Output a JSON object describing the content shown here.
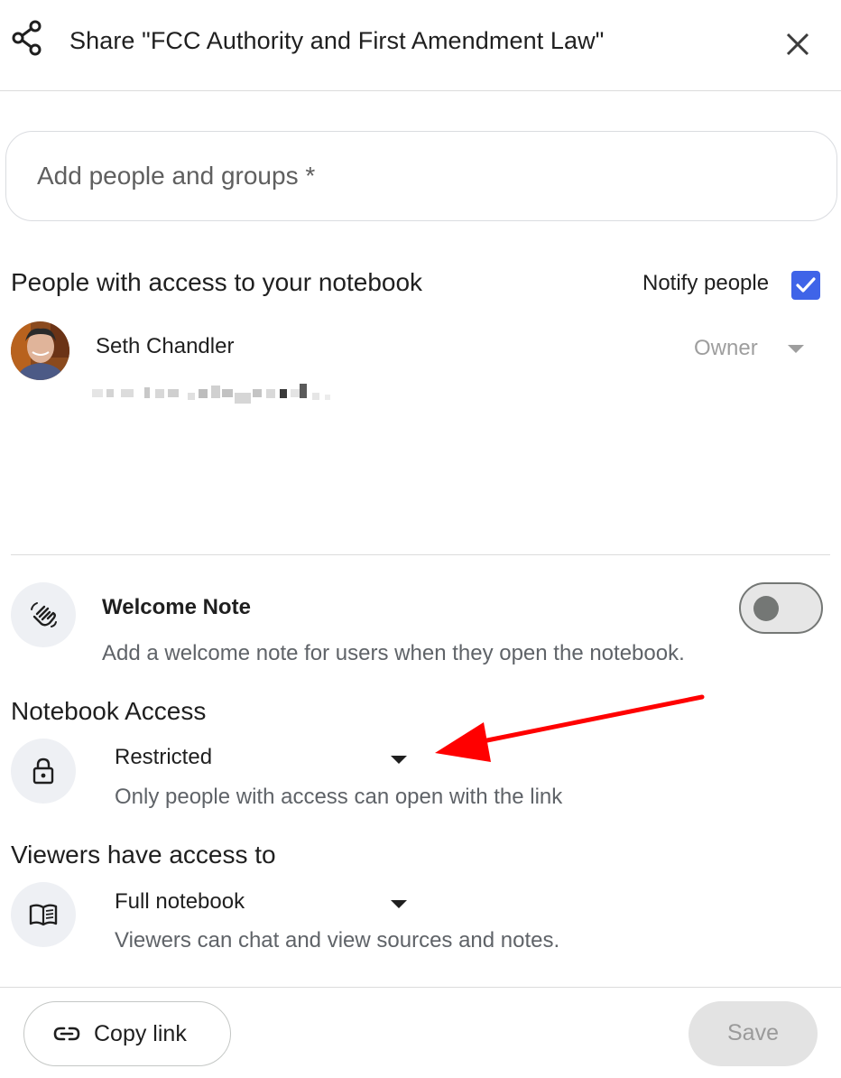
{
  "header": {
    "title": "Share \"FCC Authority and First Amendment Law\""
  },
  "add_people": {
    "placeholder": "Add people and groups *"
  },
  "people_section": {
    "heading": "People with access to your notebook",
    "notify_label": "Notify people",
    "notify_checked": true,
    "people": [
      {
        "name": "Seth Chandler",
        "role": "Owner"
      }
    ]
  },
  "welcome_note": {
    "title": "Welcome Note",
    "description": "Add a welcome note for users when they open the notebook.",
    "enabled": false
  },
  "notebook_access": {
    "heading": "Notebook Access",
    "selected": "Restricted",
    "description": "Only people with access can open with the link"
  },
  "viewers_access": {
    "heading": "Viewers have access to",
    "selected": "Full notebook",
    "description": "Viewers can chat and view sources and notes."
  },
  "footer": {
    "copy_link_label": "Copy link",
    "save_label": "Save"
  },
  "colors": {
    "accent": "#3f64e8",
    "annotation_arrow": "#ff0000"
  },
  "icons": [
    "share-icon",
    "close-icon",
    "checkbox-checked-icon",
    "waving-hand-icon",
    "lock-icon",
    "book-icon",
    "link-icon",
    "caret-down-icon"
  ]
}
